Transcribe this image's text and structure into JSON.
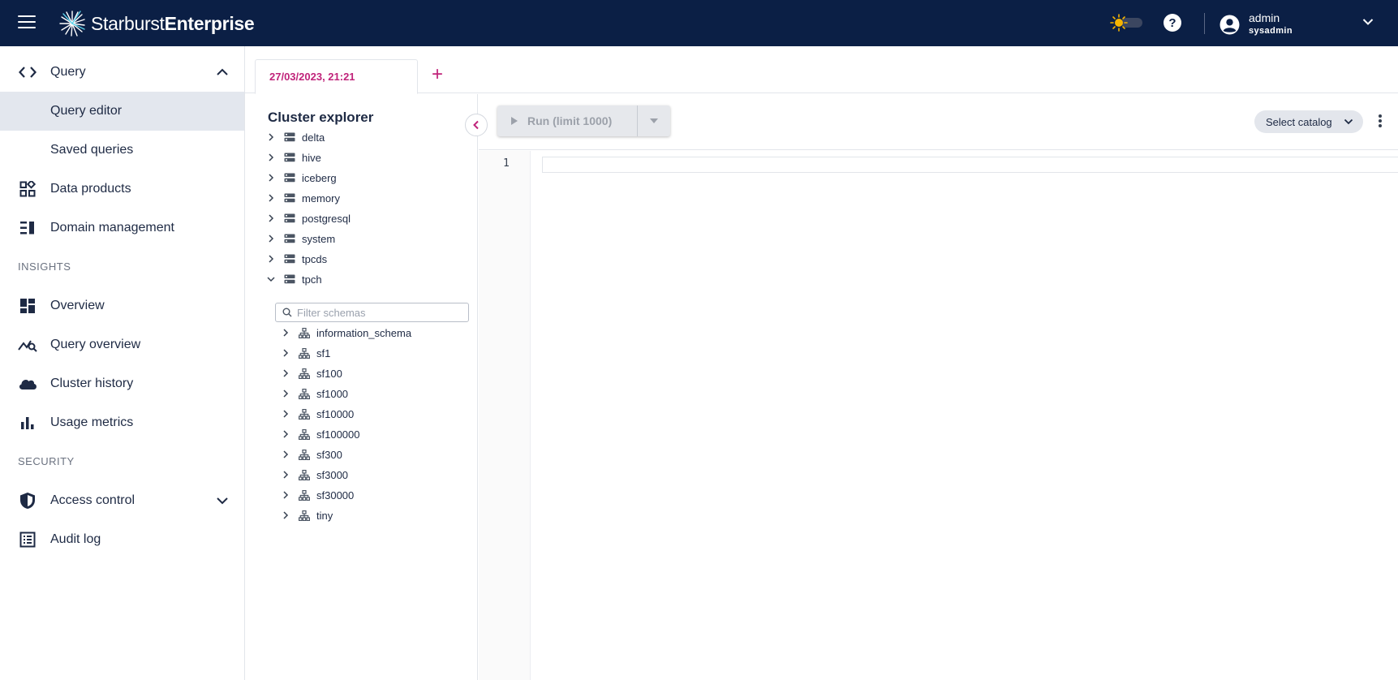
{
  "header": {
    "brand_light": "Starburst",
    "brand_bold": "Enterprise",
    "help_glyph": "?",
    "user_name": "admin",
    "user_role": "sysadmin"
  },
  "sidebar": {
    "query": "Query",
    "query_editor": "Query editor",
    "saved_queries": "Saved queries",
    "data_products": "Data products",
    "domain_management": "Domain management",
    "section_insights": "INSIGHTS",
    "overview": "Overview",
    "query_overview": "Query overview",
    "cluster_history": "Cluster history",
    "usage_metrics": "Usage metrics",
    "section_security": "SECURITY",
    "access_control": "Access control",
    "audit_log": "Audit log"
  },
  "tabs": {
    "active_label": "27/03/2023, 21:21",
    "add_glyph": "+"
  },
  "explorer": {
    "title": "Cluster explorer",
    "catalogs": [
      "delta",
      "hive",
      "iceberg",
      "memory",
      "postgresql",
      "system",
      "tpcds",
      "tpch"
    ],
    "filter_placeholder": "Filter schemas",
    "schemas": [
      "information_schema",
      "sf1",
      "sf100",
      "sf1000",
      "sf10000",
      "sf100000",
      "sf300",
      "sf3000",
      "sf30000",
      "tiny"
    ]
  },
  "editor": {
    "run_label": "Run (limit 1000)",
    "catalog_select": "Select catalog",
    "line_number": "1"
  },
  "colors": {
    "topbar": "#0b1f45",
    "accent": "#c0237a",
    "active_nav": "#e3e7ee"
  }
}
